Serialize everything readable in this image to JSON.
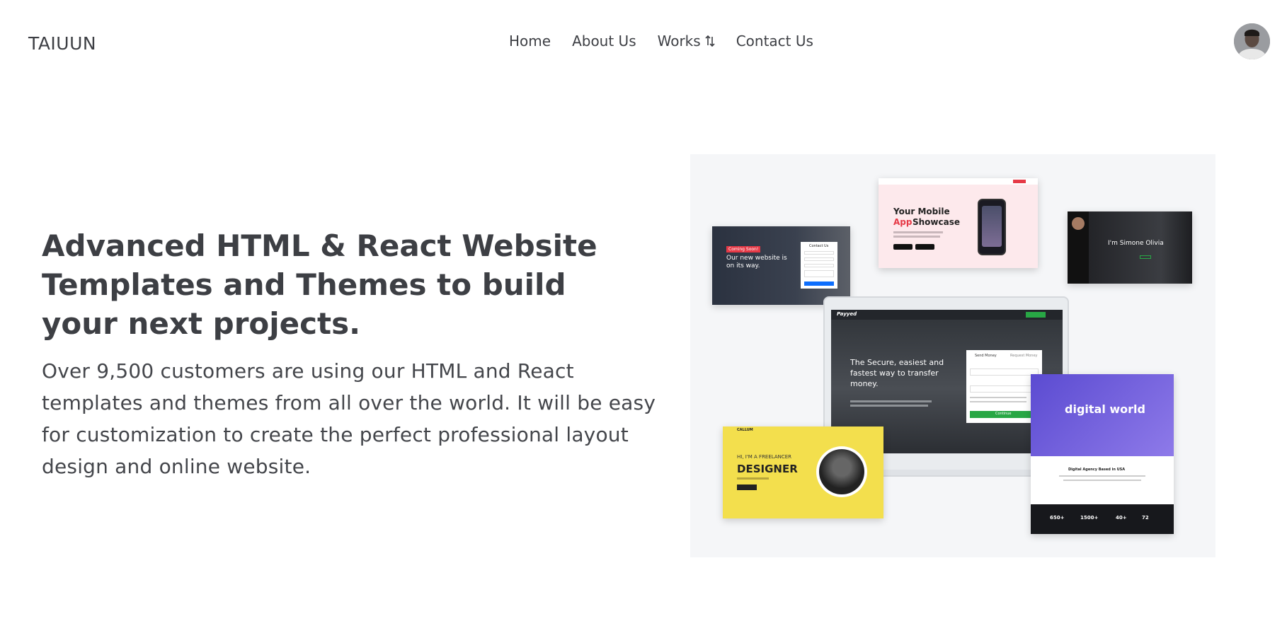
{
  "brand": "TAIUUN",
  "nav": {
    "home": "Home",
    "about": "About Us",
    "works": "Works",
    "works_icon": "sort-arrows-icon",
    "contact": "Contact Us"
  },
  "hero": {
    "title": "Advanced HTML & React Website Templates and Themes to build your next projects.",
    "text": "Over 9,500 customers are using our HTML and React templates and themes from all over the world. It will be easy for customization to create the perfect professional layout design and online website."
  },
  "showcase": {
    "coming_badge": "Coming Soon!",
    "coming_title": "Our new website is on its way.",
    "contact_us": "Contact Us",
    "app_line1": "Your Mobile",
    "app_line2a": "App",
    "app_line2b": "Showcase",
    "simone": "I'm Simone Olivia",
    "payyed_logo": "Payyed",
    "payyed_title": "The Secure, easiest and fastest way to transfer money.",
    "payyed_send": "Send Money",
    "payyed_request": "Request Money",
    "payyed_continue": "Continue",
    "callum_logo": "CALLUM",
    "freelancer": "HI, I'M A FREELANCER",
    "designer": "DESIGNER",
    "digital_world": "digital world",
    "agency": "Digital Agency Based in USA",
    "stats": [
      "650+",
      "1500+",
      "40+",
      "72"
    ],
    "colors": {
      "red": "#e63946",
      "green": "#28a745",
      "yellow": "#f3df4d",
      "purple": "#6c5ce7",
      "blue": "#0d6efd"
    }
  }
}
